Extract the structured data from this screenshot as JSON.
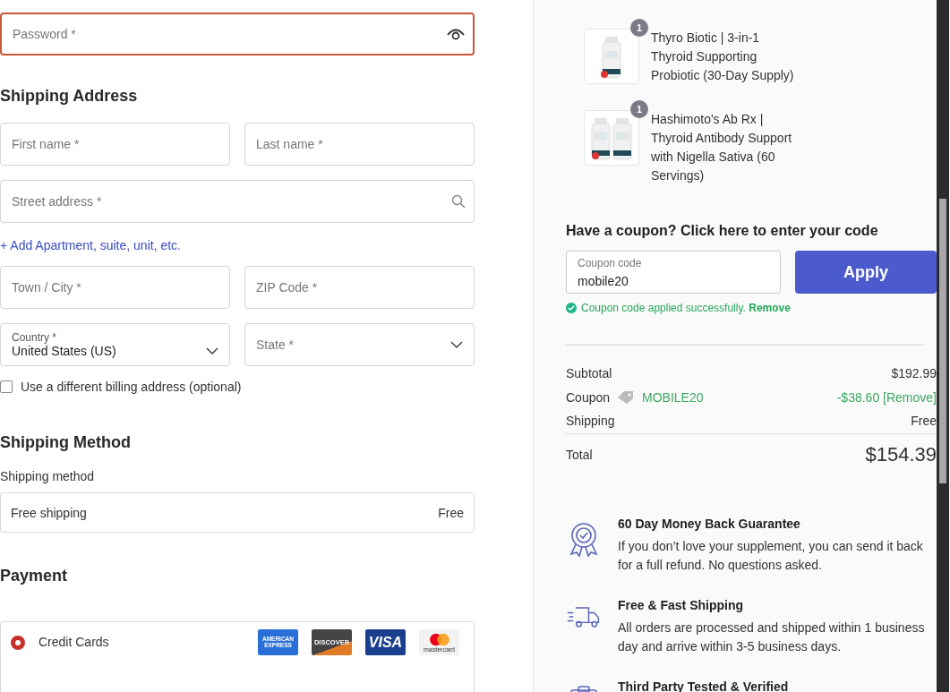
{
  "password_field": {
    "placeholder": "Password *",
    "invalid": true
  },
  "shipping_address": {
    "title": "Shipping Address",
    "rows": [
      {
        "kind": "fields",
        "fields": [
          {
            "kind": "text",
            "placeholder": "First name *"
          },
          {
            "kind": "text",
            "placeholder": "Last name *"
          }
        ]
      },
      {
        "kind": "fields",
        "fields": [
          {
            "kind": "search",
            "placeholder": "Street address *"
          }
        ]
      },
      {
        "kind": "link",
        "icon": "+",
        "label": "Add Apartment, suite, unit, etc."
      },
      {
        "kind": "fields",
        "fields": [
          {
            "kind": "text",
            "placeholder": "Town / City *"
          },
          {
            "kind": "text",
            "placeholder": "ZIP Code *"
          }
        ]
      },
      {
        "kind": "fields",
        "fields": [
          {
            "kind": "select",
            "label": "Country *",
            "value": "United States (US)"
          },
          {
            "kind": "select",
            "placeholder": "State *"
          }
        ]
      }
    ]
  },
  "billing_checkbox": {
    "label": "Use a different billing address (optional)",
    "checked": false
  },
  "shipping_method": {
    "title": "Shipping Method",
    "label": "Shipping method",
    "option": {
      "name": "Free shipping",
      "price": "Free"
    }
  },
  "payment": {
    "title": "Payment",
    "methods": [
      {
        "label": "Credit Cards",
        "selected": true,
        "cards": [
          {
            "kind": "amex",
            "lines": [
              "AMERICAN",
              "EXPRESS"
            ]
          },
          {
            "kind": "discover",
            "lines": [
              "DISCOVER"
            ]
          },
          {
            "kind": "visa",
            "lines": [
              "VISA"
            ]
          },
          {
            "kind": "mastercard",
            "lines": [
              "mastercard"
            ]
          }
        ]
      }
    ]
  },
  "order_items": [
    {
      "quantity": "1",
      "name": "Thyro Biotic | 3-in-1 Thyroid Supporting Probiotic (30-Day Supply)",
      "kind": "single"
    },
    {
      "quantity": "1",
      "name": "Hashimoto's Ab Rx | Thyroid Antibody Support with Nigella Sativa (60 Servings)",
      "kind": "double"
    }
  ],
  "coupon": {
    "title": "Have a coupon? Click here to enter your code",
    "field": {
      "label": "Coupon code",
      "value": "mobile20"
    },
    "button": "Apply",
    "message": "Coupon code applied successfully.",
    "remove_link": "Remove"
  },
  "totals": [
    {
      "kind": "subtotal",
      "label": "Subtotal",
      "value": "$192.99"
    },
    {
      "kind": "coupon",
      "label": "Coupon",
      "code": "MOBILE20",
      "value": "-$38.60 [Remove]"
    },
    {
      "kind": "shipping",
      "label": "Shipping",
      "value": "Free"
    },
    {
      "kind": "total",
      "label": "Total",
      "value": "$154.39"
    }
  ],
  "guarantees": [
    {
      "kind": "ribbon",
      "title": "60 Day Money Back Guarantee",
      "text": "If you don’t love your supplement, you can send it back for a full refund. No questions asked."
    },
    {
      "kind": "truck",
      "title": "Free & Fast Shipping",
      "text": "All orders are processed and shipped within 1 business day and arrive within 3-5 business days."
    },
    {
      "kind": "clipboard",
      "title": "Third Party Tested & Verified"
    }
  ]
}
